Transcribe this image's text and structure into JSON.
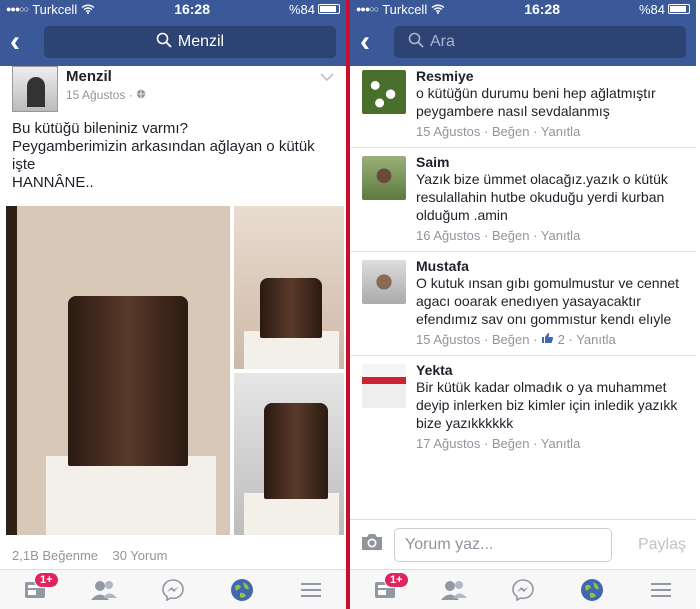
{
  "status": {
    "dots": "●●●○○",
    "carrier": "Turkcell",
    "time": "16:28",
    "battery": "%84"
  },
  "left": {
    "search_title": "Menzil",
    "post": {
      "author": "Menzil",
      "date": "15 Ağustos · ",
      "text_lines": [
        "Bu kütüğü bileniniz varmı?",
        "Peygamberimizin arkasından ağlayan o kütük işte",
        "HANNÂNE.."
      ],
      "likes": "2,1B Beğenme",
      "comments": "30 Yorum"
    }
  },
  "right": {
    "search_placeholder": "Ara",
    "comments": [
      {
        "name": "Resmiye",
        "text": "o kütüğün durumu beni hep ağlatmıştır peygambere nasıl sevdalanmış",
        "meta": "15 Ağustos · Beğen · Yanıtla"
      },
      {
        "name": "Saim",
        "text": "Yazık bize ümmet olacağız.yazık o kütük resulallahin hutbe okuduğu yerdi kurban olduğum .amin",
        "meta": "16 Ağustos · Beğen · Yanıtla"
      },
      {
        "name": "Mustafa",
        "text": "O kutuk ınsan gıbı gomulmustur ve cennet agacı ooarak enedıyen yasayacaktır efendımız sav onı gommıstur kendı elıyle",
        "meta": "15 Ağustos · Beğen · ",
        "like_count": "2",
        "meta_tail": " · Yanıtla"
      },
      {
        "name": "Yekta",
        "text": "Bir kütük kadar olmadık o ya muhammet deyip inlerken biz kimler için inledik yazıkk bize yazıkkkkkk",
        "meta": "17 Ağustos · Beğen · Yanıtla"
      }
    ],
    "composer": {
      "placeholder": "Yorum yaz...",
      "send": "Paylaş"
    }
  },
  "tabbar": {
    "badge": "1+"
  },
  "colors": {
    "brand": "#3b5998",
    "divider": "#c8102e",
    "badge": "#e0245e"
  }
}
